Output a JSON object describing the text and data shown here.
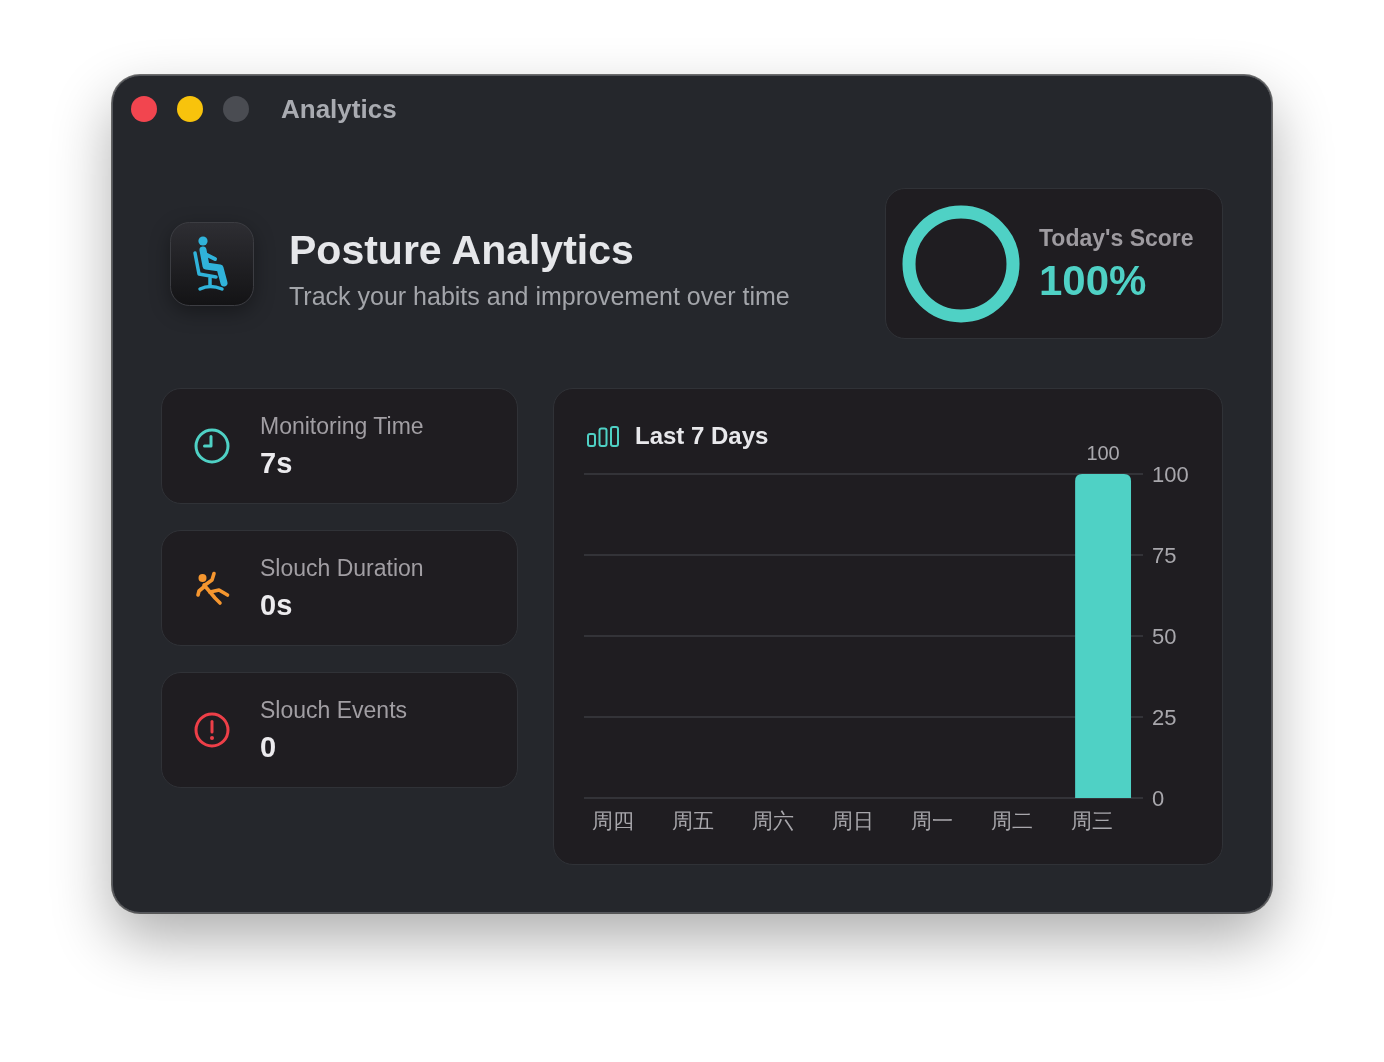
{
  "window": {
    "title": "Analytics",
    "controls": [
      {
        "kind": "close",
        "disabled": false
      },
      {
        "kind": "minimize",
        "disabled": false
      },
      {
        "kind": "zoom",
        "disabled": true
      }
    ]
  },
  "header": {
    "title": "Posture Analytics",
    "subtitle": "Track your habits and improvement over time"
  },
  "score": {
    "label": "Today's Score",
    "value": "100%",
    "level": 1
  },
  "stats": [
    {
      "label": "Monitoring Time",
      "value": "7s",
      "color": "#4fd1c5"
    },
    {
      "label": "Slouch Duration",
      "value": "0s",
      "color": "#f5962f"
    },
    {
      "label": "Slouch Events",
      "value": "0",
      "color": "#ee3f48"
    }
  ],
  "chart": {
    "chart_data": {
      "type": "bar",
      "title": "Last 7 Days",
      "categories": [
        "周四",
        "周五",
        "周六",
        "周日",
        "周一",
        "周二",
        "周三"
      ],
      "values": [
        0,
        0,
        0,
        0,
        0,
        0,
        100
      ],
      "ylim": [
        0,
        100
      ],
      "yticks": [
        0,
        25,
        50,
        75,
        100
      ],
      "grid": true,
      "value_labels": [
        null,
        null,
        null,
        null,
        null,
        null,
        "100"
      ]
    }
  }
}
